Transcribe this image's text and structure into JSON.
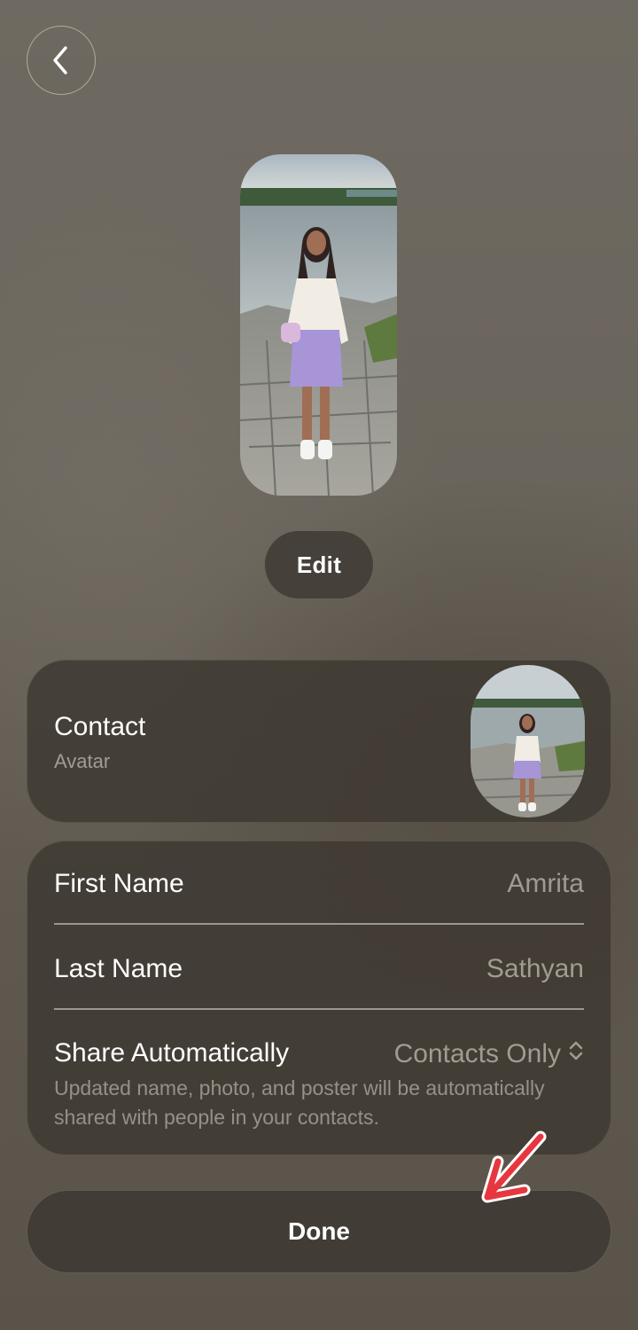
{
  "header": {
    "back_icon": "chevron-left-icon"
  },
  "poster": {
    "image": "contact-poster-photo"
  },
  "edit_button": {
    "label": "Edit"
  },
  "contact_card": {
    "title": "Contact",
    "subtitle": "Avatar",
    "avatar_image": "contact-avatar-photo"
  },
  "info": {
    "first_name": {
      "label": "First Name",
      "value": "Amrita"
    },
    "last_name": {
      "label": "Last Name",
      "value": "Sathyan"
    },
    "share": {
      "label": "Share Automatically",
      "value": "Contacts Only",
      "icon": "chevron-up-down-icon",
      "note": "Updated name, photo, and poster will be automatically shared with people in your contacts."
    }
  },
  "done_button": {
    "label": "Done"
  },
  "annotation": {
    "icon": "red-arrow-icon",
    "color": "#e8363f"
  }
}
